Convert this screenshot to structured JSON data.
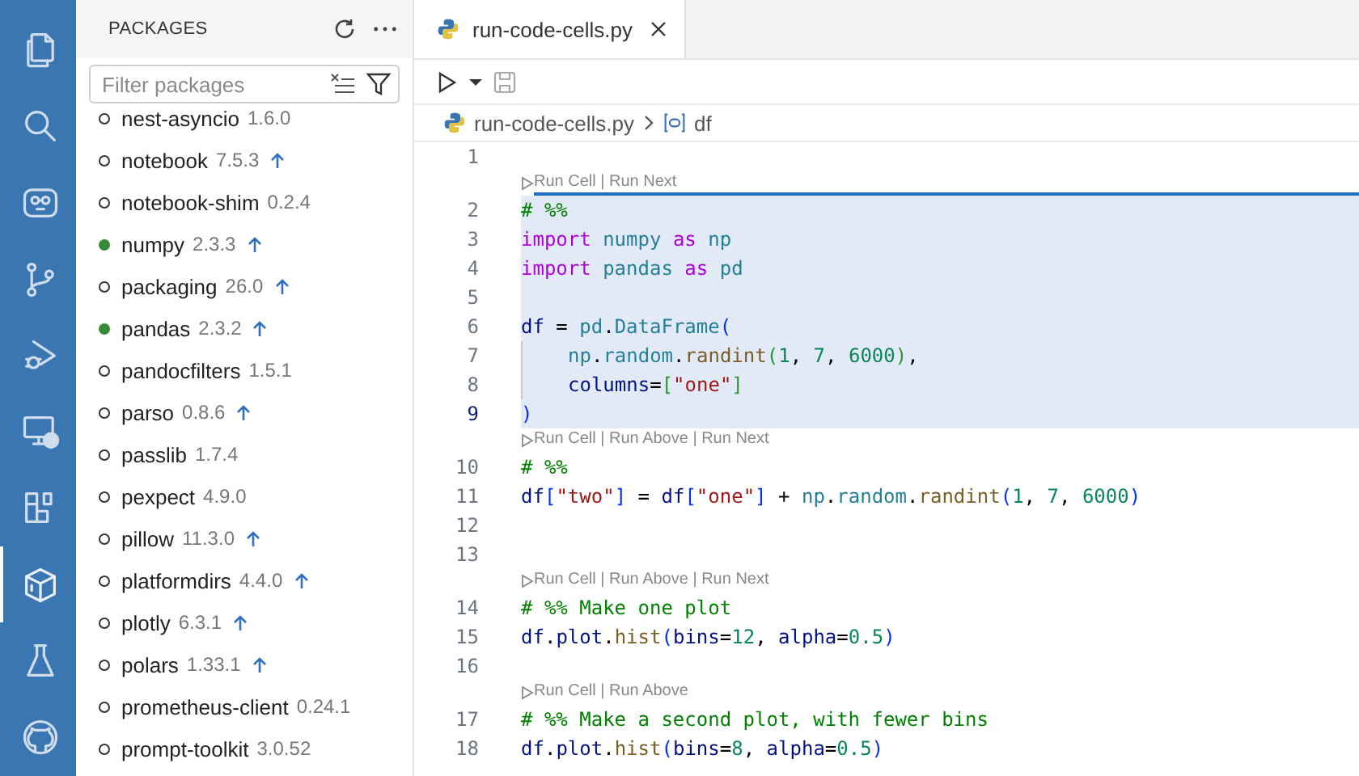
{
  "activity_bar": {
    "items": [
      {
        "kind": "files",
        "selected": false
      },
      {
        "kind": "search",
        "selected": false
      },
      {
        "kind": "robot",
        "selected": false
      },
      {
        "kind": "branch",
        "selected": false
      },
      {
        "kind": "debug",
        "selected": false
      },
      {
        "kind": "remote",
        "selected": false
      },
      {
        "kind": "extensions",
        "selected": false
      },
      {
        "kind": "box",
        "selected": true
      },
      {
        "kind": "flask",
        "selected": false
      },
      {
        "kind": "github",
        "selected": false
      }
    ]
  },
  "sidebar": {
    "title": "PACKAGES",
    "filter": {
      "placeholder": "Filter packages"
    },
    "packages": [
      {
        "name": "nest-asyncio",
        "version": "1.6.0",
        "imported": false,
        "update": false
      },
      {
        "name": "notebook",
        "version": "7.5.3",
        "imported": false,
        "update": true
      },
      {
        "name": "notebook-shim",
        "version": "0.2.4",
        "imported": false,
        "update": false
      },
      {
        "name": "numpy",
        "version": "2.3.3",
        "imported": true,
        "update": true
      },
      {
        "name": "packaging",
        "version": "26.0",
        "imported": false,
        "update": true
      },
      {
        "name": "pandas",
        "version": "2.3.2",
        "imported": true,
        "update": true
      },
      {
        "name": "pandocfilters",
        "version": "1.5.1",
        "imported": false,
        "update": false
      },
      {
        "name": "parso",
        "version": "0.8.6",
        "imported": false,
        "update": true
      },
      {
        "name": "passlib",
        "version": "1.7.4",
        "imported": false,
        "update": false
      },
      {
        "name": "pexpect",
        "version": "4.9.0",
        "imported": false,
        "update": false
      },
      {
        "name": "pillow",
        "version": "11.3.0",
        "imported": false,
        "update": true
      },
      {
        "name": "platformdirs",
        "version": "4.4.0",
        "imported": false,
        "update": true
      },
      {
        "name": "plotly",
        "version": "6.3.1",
        "imported": false,
        "update": true
      },
      {
        "name": "polars",
        "version": "1.33.1",
        "imported": false,
        "update": true
      },
      {
        "name": "prometheus-client",
        "version": "0.24.1",
        "imported": false,
        "update": false
      },
      {
        "name": "prompt-toolkit",
        "version": "3.0.52",
        "imported": false,
        "update": false
      }
    ]
  },
  "editor": {
    "tab": {
      "title": "run-code-cells.py",
      "selected": true
    },
    "breadcrumb": {
      "file": "run-code-cells.py",
      "symbol": "df"
    },
    "rows": [
      {
        "kind": "code",
        "number": "1",
        "current": false,
        "active_cell": false,
        "indent": false,
        "tokens": []
      },
      {
        "kind": "codelens",
        "active_cell": true,
        "text": "Run Cell | Run Next"
      },
      {
        "kind": "code",
        "number": "2",
        "current": false,
        "active_cell": true,
        "indent": false,
        "tokens": [
          {
            "text": "# %%",
            "color": "#008000"
          }
        ]
      },
      {
        "kind": "code",
        "number": "3",
        "current": false,
        "active_cell": true,
        "indent": false,
        "tokens": [
          {
            "text": "import ",
            "color": "#af00db"
          },
          {
            "text": "numpy ",
            "color": "#267f99"
          },
          {
            "text": "as ",
            "color": "#af00db"
          },
          {
            "text": "np",
            "color": "#267f99"
          }
        ]
      },
      {
        "kind": "code",
        "number": "4",
        "current": false,
        "active_cell": true,
        "indent": false,
        "tokens": [
          {
            "text": "import ",
            "color": "#af00db"
          },
          {
            "text": "pandas ",
            "color": "#267f99"
          },
          {
            "text": "as ",
            "color": "#af00db"
          },
          {
            "text": "pd",
            "color": "#267f99"
          }
        ]
      },
      {
        "kind": "code",
        "number": "5",
        "current": false,
        "active_cell": true,
        "indent": false,
        "tokens": []
      },
      {
        "kind": "code",
        "number": "6",
        "current": false,
        "active_cell": true,
        "indent": false,
        "tokens": [
          {
            "text": "df",
            "color": "#001080"
          },
          {
            "text": " = ",
            "color": "#000000"
          },
          {
            "text": "pd",
            "color": "#267f99"
          },
          {
            "text": ".",
            "color": "#000000"
          },
          {
            "text": "DataFrame",
            "color": "#267f99"
          },
          {
            "text": "(",
            "color": "#0431fa"
          }
        ]
      },
      {
        "kind": "code",
        "number": "7",
        "current": false,
        "active_cell": true,
        "indent": true,
        "tokens": [
          {
            "text": "np",
            "color": "#267f99"
          },
          {
            "text": ".",
            "color": "#000000"
          },
          {
            "text": "random",
            "color": "#267f99"
          },
          {
            "text": ".",
            "color": "#000000"
          },
          {
            "text": "randint",
            "color": "#795e26"
          },
          {
            "text": "(",
            "color": "#319331"
          },
          {
            "text": "1",
            "color": "#098658"
          },
          {
            "text": ", ",
            "color": "#000000"
          },
          {
            "text": "7",
            "color": "#098658"
          },
          {
            "text": ", ",
            "color": "#000000"
          },
          {
            "text": "6000",
            "color": "#098658"
          },
          {
            "text": ")",
            "color": "#319331"
          },
          {
            "text": ",",
            "color": "#000000"
          }
        ]
      },
      {
        "kind": "code",
        "number": "8",
        "current": false,
        "active_cell": true,
        "indent": true,
        "tokens": [
          {
            "text": "columns",
            "color": "#001080"
          },
          {
            "text": "=",
            "color": "#000000"
          },
          {
            "text": "[",
            "color": "#319331"
          },
          {
            "text": "\"one\"",
            "color": "#a31515"
          },
          {
            "text": "]",
            "color": "#319331"
          }
        ]
      },
      {
        "kind": "code",
        "number": "9",
        "current": true,
        "active_cell": true,
        "indent": false,
        "tokens": [
          {
            "text": ")",
            "color": "#0431fa"
          }
        ]
      },
      {
        "kind": "codelens",
        "active_cell": false,
        "text": "Run Cell | Run Above | Run Next"
      },
      {
        "kind": "code",
        "number": "10",
        "current": false,
        "active_cell": false,
        "indent": false,
        "tokens": [
          {
            "text": "# %%",
            "color": "#008000"
          }
        ]
      },
      {
        "kind": "code",
        "number": "11",
        "current": false,
        "active_cell": false,
        "indent": false,
        "tokens": [
          {
            "text": "df",
            "color": "#001080"
          },
          {
            "text": "[",
            "color": "#0431fa"
          },
          {
            "text": "\"two\"",
            "color": "#a31515"
          },
          {
            "text": "]",
            "color": "#0431fa"
          },
          {
            "text": " = ",
            "color": "#000000"
          },
          {
            "text": "df",
            "color": "#001080"
          },
          {
            "text": "[",
            "color": "#0431fa"
          },
          {
            "text": "\"one\"",
            "color": "#a31515"
          },
          {
            "text": "]",
            "color": "#0431fa"
          },
          {
            "text": " + ",
            "color": "#000000"
          },
          {
            "text": "np",
            "color": "#267f99"
          },
          {
            "text": ".",
            "color": "#000000"
          },
          {
            "text": "random",
            "color": "#267f99"
          },
          {
            "text": ".",
            "color": "#000000"
          },
          {
            "text": "randint",
            "color": "#795e26"
          },
          {
            "text": "(",
            "color": "#0431fa"
          },
          {
            "text": "1",
            "color": "#098658"
          },
          {
            "text": ", ",
            "color": "#000000"
          },
          {
            "text": "7",
            "color": "#098658"
          },
          {
            "text": ", ",
            "color": "#000000"
          },
          {
            "text": "6000",
            "color": "#098658"
          },
          {
            "text": ")",
            "color": "#0431fa"
          }
        ]
      },
      {
        "kind": "code",
        "number": "12",
        "current": false,
        "active_cell": false,
        "indent": false,
        "tokens": []
      },
      {
        "kind": "code",
        "number": "13",
        "current": false,
        "active_cell": false,
        "indent": false,
        "tokens": []
      },
      {
        "kind": "codelens",
        "active_cell": false,
        "text": "Run Cell | Run Above | Run Next"
      },
      {
        "kind": "code",
        "number": "14",
        "current": false,
        "active_cell": false,
        "indent": false,
        "tokens": [
          {
            "text": "# %% Make one plot",
            "color": "#008000"
          }
        ]
      },
      {
        "kind": "code",
        "number": "15",
        "current": false,
        "active_cell": false,
        "indent": false,
        "tokens": [
          {
            "text": "df",
            "color": "#001080"
          },
          {
            "text": ".",
            "color": "#000000"
          },
          {
            "text": "plot",
            "color": "#001080"
          },
          {
            "text": ".",
            "color": "#000000"
          },
          {
            "text": "hist",
            "color": "#795e26"
          },
          {
            "text": "(",
            "color": "#0431fa"
          },
          {
            "text": "bins",
            "color": "#001080"
          },
          {
            "text": "=",
            "color": "#000000"
          },
          {
            "text": "12",
            "color": "#098658"
          },
          {
            "text": ", ",
            "color": "#000000"
          },
          {
            "text": "alpha",
            "color": "#001080"
          },
          {
            "text": "=",
            "color": "#000000"
          },
          {
            "text": "0.5",
            "color": "#098658"
          },
          {
            "text": ")",
            "color": "#0431fa"
          }
        ]
      },
      {
        "kind": "code",
        "number": "16",
        "current": false,
        "active_cell": false,
        "indent": false,
        "tokens": []
      },
      {
        "kind": "codelens",
        "active_cell": false,
        "text": "Run Cell | Run Above"
      },
      {
        "kind": "code",
        "number": "17",
        "current": false,
        "active_cell": false,
        "indent": false,
        "tokens": [
          {
            "text": "# %% Make a second plot, with fewer bins",
            "color": "#008000"
          }
        ]
      },
      {
        "kind": "code",
        "number": "18",
        "current": false,
        "active_cell": false,
        "indent": false,
        "tokens": [
          {
            "text": "df",
            "color": "#001080"
          },
          {
            "text": ".",
            "color": "#000000"
          },
          {
            "text": "plot",
            "color": "#001080"
          },
          {
            "text": ".",
            "color": "#000000"
          },
          {
            "text": "hist",
            "color": "#795e26"
          },
          {
            "text": "(",
            "color": "#0431fa"
          },
          {
            "text": "bins",
            "color": "#001080"
          },
          {
            "text": "=",
            "color": "#000000"
          },
          {
            "text": "8",
            "color": "#098658"
          },
          {
            "text": ", ",
            "color": "#000000"
          },
          {
            "text": "alpha",
            "color": "#001080"
          },
          {
            "text": "=",
            "color": "#000000"
          },
          {
            "text": "0.5",
            "color": "#098658"
          },
          {
            "text": ")",
            "color": "#0431fa"
          }
        ]
      }
    ]
  }
}
